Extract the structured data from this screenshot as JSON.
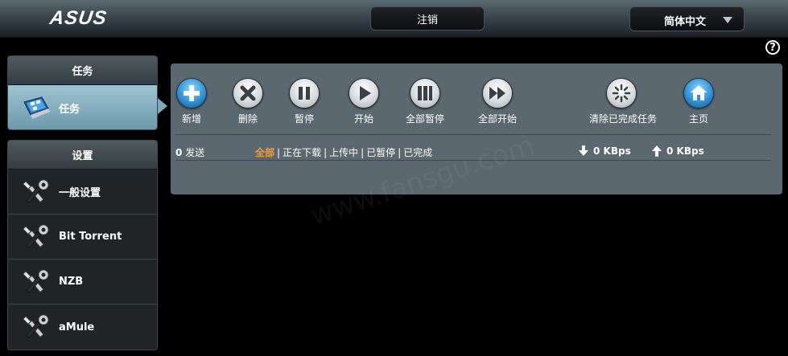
{
  "header": {
    "logo": "ASUS",
    "logout_label": "注销",
    "language_selected": "简体中文",
    "help_label": "?"
  },
  "sidebar": {
    "task_section": {
      "title": "任务",
      "items": [
        {
          "label": "任务",
          "icon": "task-monitor-icon",
          "active": true
        }
      ]
    },
    "settings_section": {
      "title": "设置",
      "items": [
        {
          "label": "一般设置",
          "icon": "tools-icon"
        },
        {
          "label": "Bit Torrent",
          "icon": "tools-icon"
        },
        {
          "label": "NZB",
          "icon": "tools-icon"
        },
        {
          "label": "aMule",
          "icon": "tools-icon"
        }
      ]
    }
  },
  "toolbar": {
    "add": "新增",
    "delete": "删除",
    "pause": "暂停",
    "start": "开始",
    "pause_all": "全部暂停",
    "start_all": "全部开始",
    "clear_done": "清除已完成任务",
    "home": "主页"
  },
  "status": {
    "count": "0",
    "count_label": "发送",
    "filters": [
      "全部",
      "正在下载",
      "上传中",
      "已暂停",
      "已完成"
    ],
    "active_filter": "全部",
    "download_speed": "0 KBps",
    "upload_speed": "0 KBps"
  },
  "watermark": "www.fansgu.com",
  "colors": {
    "accent_active_filter": "#f0a030",
    "panel_bg": "#5b6870",
    "active_menu": "#7fa9b9",
    "home_button": "#2e93d8"
  }
}
